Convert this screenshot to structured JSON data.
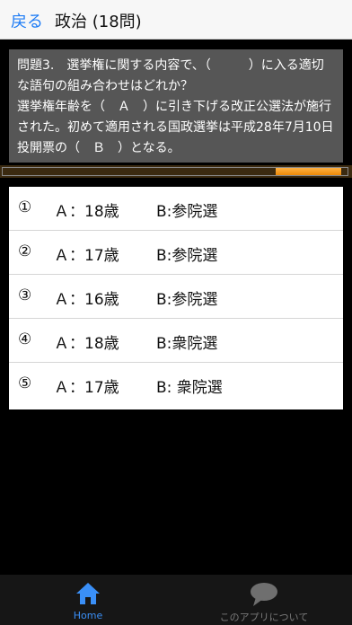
{
  "nav": {
    "back_label": "戻る",
    "title": "政治 (18問)"
  },
  "question": {
    "line1": "問題3.　選挙権に関する内容で、（　　　）に入る適切な語句の組み合わせはどれか？",
    "line2": "選挙権年齢を（　Ａ　）に引き下げる改正公選法が施行された。初めて適用される国政選挙は平成28年7月10日投開票の（　Ｂ　）となる。"
  },
  "progress": {
    "fraction": 0.19
  },
  "choices": [
    {
      "num": "①",
      "a": "Ａ：18歳",
      "b": "B:参院選"
    },
    {
      "num": "②",
      "a": "Ａ：17歳",
      "b": "B:参院選"
    },
    {
      "num": "③",
      "a": "Ａ：16歳",
      "b": "B:参院選"
    },
    {
      "num": "④",
      "a": "Ａ：18歳",
      "b": "B:衆院選"
    },
    {
      "num": "⑤",
      "a": "Ａ：17歳",
      "b": "B: 衆院選"
    }
  ],
  "tabs": [
    {
      "label": "Home",
      "icon": "home-icon",
      "active": true,
      "color": "#3a8ff7"
    },
    {
      "label": "このアプリについて",
      "icon": "speech-bubble-icon",
      "active": false,
      "color": "#7a7a7a"
    }
  ]
}
